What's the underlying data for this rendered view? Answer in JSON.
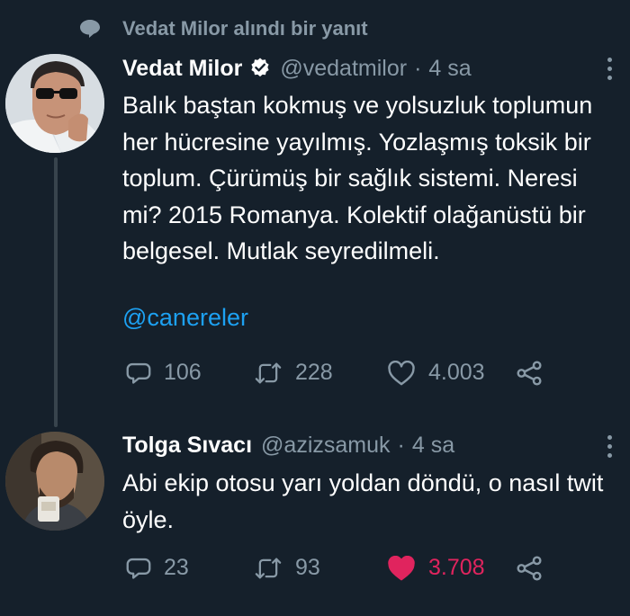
{
  "context": {
    "text": "Vedat Milor alındı bir yanıt",
    "icon": "speech-bubble-icon"
  },
  "tweet1": {
    "name": "Vedat Milor",
    "verified": true,
    "handle": "@vedatmilor",
    "separator": "·",
    "time": "4 sa",
    "text": "Balık baştan kokmuş ve yolsuzluk toplumun her hücresine yayılmış. Yozlaşmış toksik bir toplum. Çürümüş bir sağlık sistemi. Neresi mi? 2015 Romanya. Kolektif olağanüstü bir belgesel. Mutlak seyredilmeli.",
    "mention": "@canereler",
    "replies": "106",
    "retweets": "228",
    "likes": "4.003"
  },
  "tweet2": {
    "name": "Tolga Sıvacı",
    "handle": "@azizsamuk",
    "separator": "·",
    "time": "4 sa",
    "text": "Abi ekip otosu yarı yoldan döndü, o nasıl twit öyle.",
    "replies": "23",
    "retweets": "93",
    "likes": "3.708",
    "liked": true
  },
  "colors": {
    "background": "#15202b",
    "secondary_text": "#8899a6",
    "link": "#1da1f2",
    "like_active": "#e0245e",
    "thread_line": "#38444d"
  }
}
